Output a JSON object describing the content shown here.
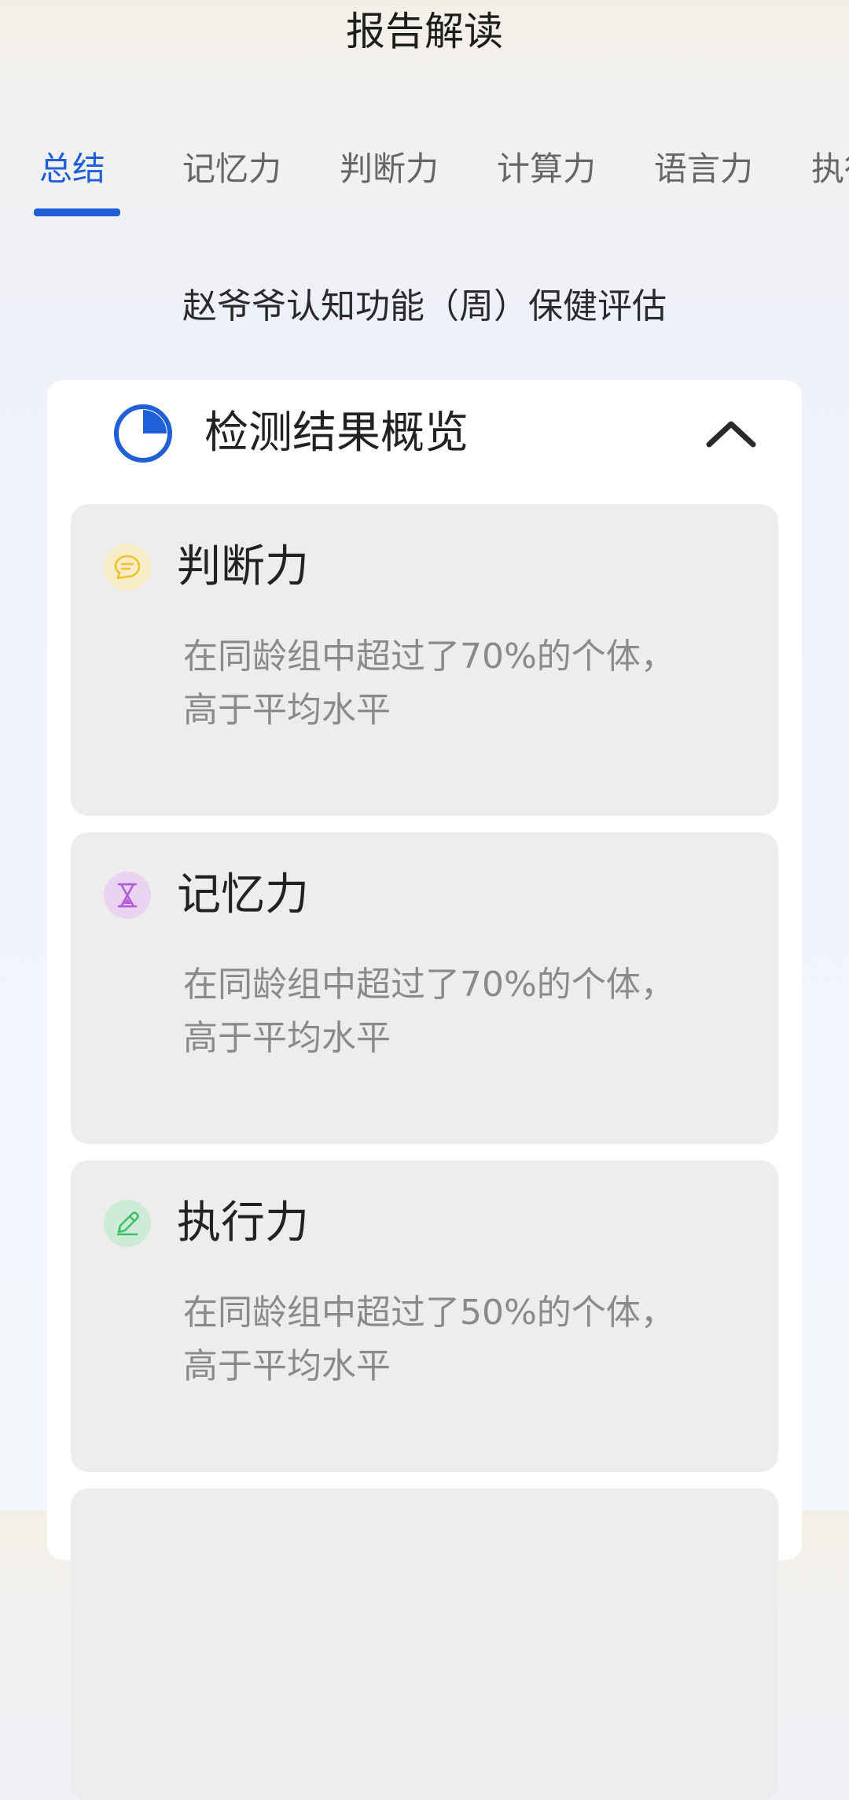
{
  "header": {
    "title": "报告解读"
  },
  "tabs": [
    {
      "label": "总结",
      "active": true
    },
    {
      "label": "记忆力",
      "active": false
    },
    {
      "label": "判断力",
      "active": false
    },
    {
      "label": "计算力",
      "active": false
    },
    {
      "label": "语言力",
      "active": false
    },
    {
      "label": "执行力",
      "active": false
    }
  ],
  "report": {
    "title": "赵爷爷认知功能（周）保健评估"
  },
  "overview": {
    "title": "检测结果概览",
    "icon": "pie-chart-icon",
    "accent_color": "#1f5fd8",
    "collapse_icon": "chevron-up-icon",
    "items": [
      {
        "title": "判断力",
        "icon": "chat-bubble-icon",
        "icon_color": "#f3c53a",
        "line1": "在同龄组中超过了70%的个体，",
        "line2": "高于平均水平",
        "percent": 70
      },
      {
        "title": "记忆力",
        "icon": "hourglass-icon",
        "icon_color": "#b45bd9",
        "line1": "在同龄组中超过了70%的个体，",
        "line2": "高于平均水平",
        "percent": 70
      },
      {
        "title": "执行力",
        "icon": "pencil-icon",
        "icon_color": "#3fbf6a",
        "line1": "在同龄组中超过了50%的个体，",
        "line2": "高于平均水平",
        "percent": 50
      }
    ]
  }
}
